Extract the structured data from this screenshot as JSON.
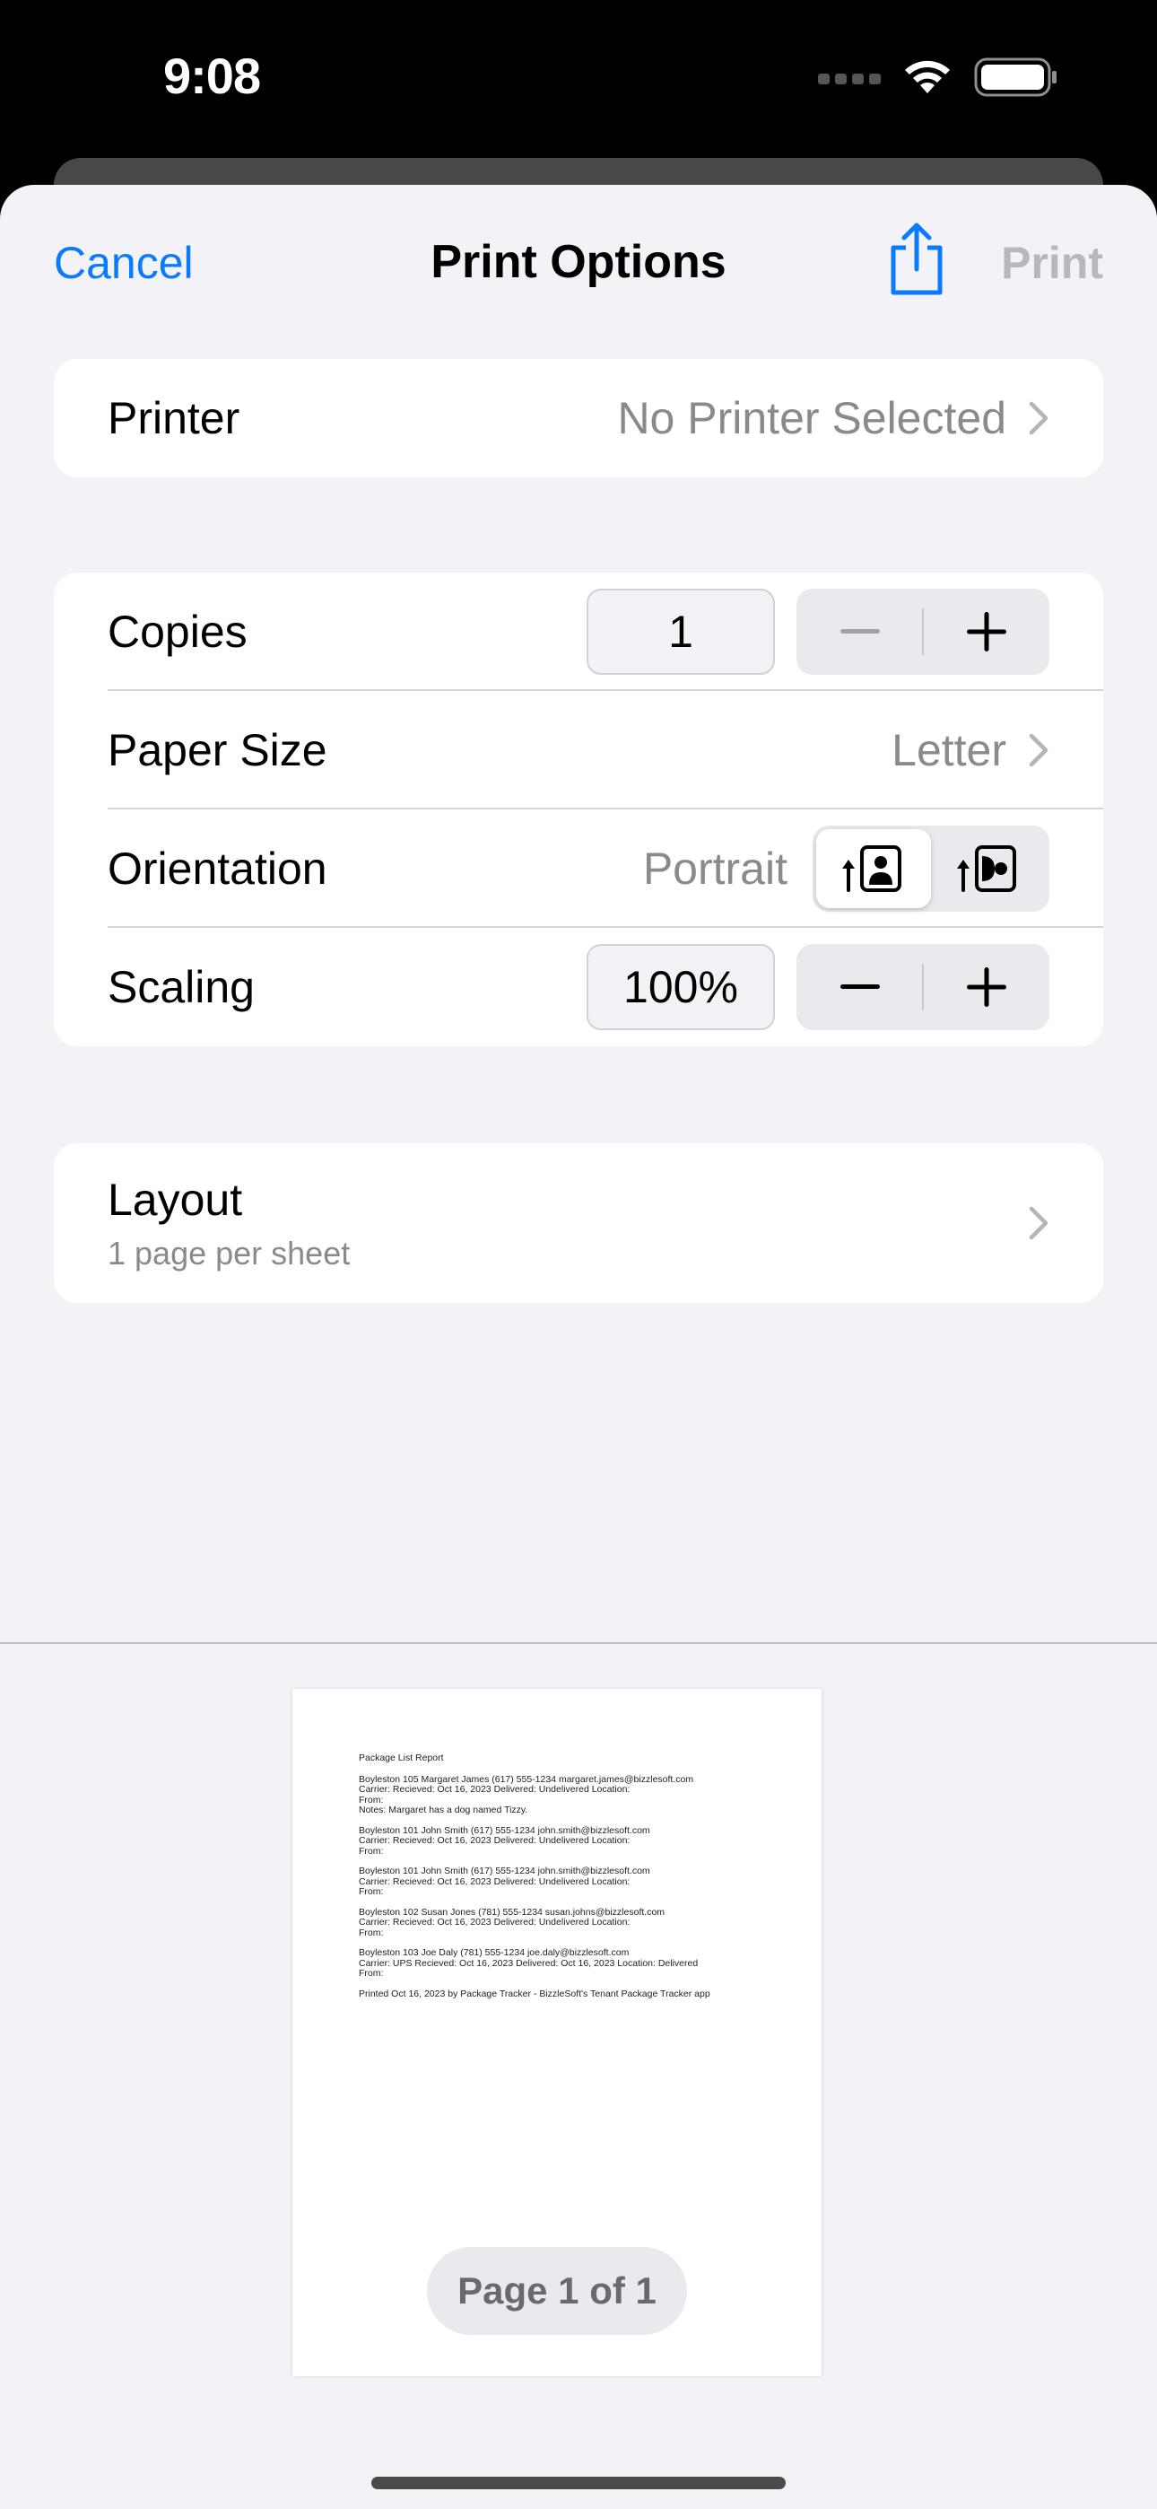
{
  "status_bar": {
    "time": "9:08"
  },
  "nav": {
    "cancel_label": "Cancel",
    "title": "Print Options",
    "print_label": "Print"
  },
  "printer": {
    "label": "Printer",
    "value": "No Printer Selected"
  },
  "settings": {
    "copies": {
      "label": "Copies",
      "value": "1"
    },
    "paper_size": {
      "label": "Paper Size",
      "value": "Letter"
    },
    "orientation": {
      "label": "Orientation",
      "value": "Portrait",
      "options": [
        "portrait-icon",
        "landscape-icon"
      ],
      "selected": "portrait"
    },
    "scaling": {
      "label": "Scaling",
      "value": "100%"
    }
  },
  "layout": {
    "label": "Layout",
    "value": "1 page per sheet"
  },
  "preview": {
    "title": "Package List Report",
    "entries": [
      [
        "Boyleston 105 Margaret James (617) 555-1234 margaret.james@bizzlesoft.com",
        "Carrier:   Recieved: Oct 16, 2023 Delivered: Undelivered Location:",
        "From:",
        "Notes: Margaret has a dog named Tizzy."
      ],
      [
        "Boyleston 101 John Smith (617) 555-1234 john.smith@bizzlesoft.com",
        "Carrier:   Recieved: Oct 16, 2023 Delivered: Undelivered Location:",
        "From:"
      ],
      [
        "Boyleston 101 John Smith (617) 555-1234 john.smith@bizzlesoft.com",
        "Carrier:   Recieved: Oct 16, 2023 Delivered: Undelivered Location:",
        "From:"
      ],
      [
        "Boyleston 102 Susan Jones (781) 555-1234 susan.johns@bizzlesoft.com",
        "Carrier:   Recieved: Oct 16, 2023 Delivered: Undelivered Location:",
        "From:"
      ],
      [
        "Boyleston 103 Joe Daly (781) 555-1234 joe.daly@bizzlesoft.com",
        "Carrier: UPS  Recieved: Oct 16, 2023 Delivered: Oct 16, 2023 Location: Delivered",
        "From:"
      ]
    ],
    "footer": "Printed Oct 16, 2023 by Package Tracker - BizzleSoft's Tenant Package Tracker app",
    "page_indicator": "Page 1 of 1"
  },
  "colors": {
    "accent": "#0a7aff",
    "background": "#f2f2f7",
    "secondary_text": "#8a8a8e"
  }
}
